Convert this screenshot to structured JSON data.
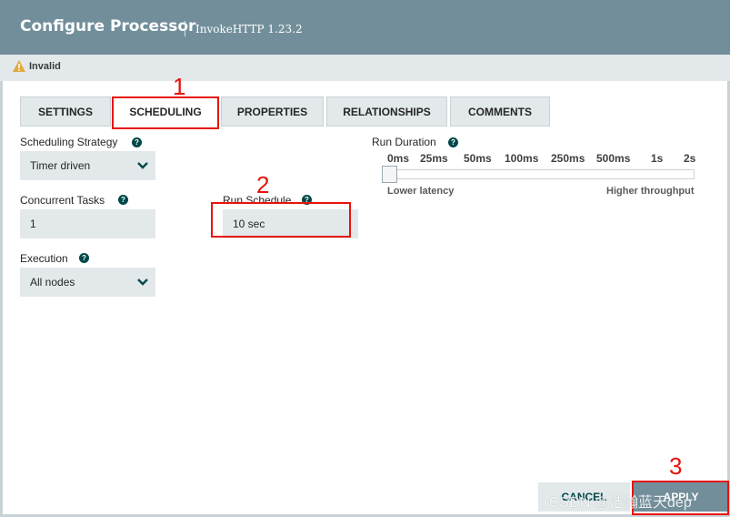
{
  "header": {
    "title": "Configure Processor",
    "subtitle": "InvokeHTTP 1.23.2"
  },
  "status": {
    "icon": "warning-icon",
    "text": "Invalid"
  },
  "tabs": [
    {
      "label": "SETTINGS",
      "active": false
    },
    {
      "label": "SCHEDULING",
      "active": true
    },
    {
      "label": "PROPERTIES",
      "active": false
    },
    {
      "label": "RELATIONSHIPS",
      "active": false
    },
    {
      "label": "COMMENTS",
      "active": false
    }
  ],
  "form": {
    "scheduling_strategy": {
      "label": "Scheduling Strategy",
      "value": "Timer driven"
    },
    "concurrent_tasks": {
      "label": "Concurrent Tasks",
      "value": "1"
    },
    "run_schedule": {
      "label": "Run Schedule",
      "value": "10 sec"
    },
    "execution": {
      "label": "Execution",
      "value": "All nodes"
    },
    "run_duration": {
      "label": "Run Duration",
      "ticks": [
        "0ms",
        "25ms",
        "50ms",
        "100ms",
        "250ms",
        "500ms",
        "1s",
        "2s"
      ],
      "selected": "0ms",
      "low_label": "Lower latency",
      "high_label": "Higher throughput"
    }
  },
  "help_glyph": "?",
  "annotations": [
    "1",
    "2",
    "3"
  ],
  "buttons": {
    "cancel": "CANCEL",
    "apply": "APPLY"
  },
  "watermark": "CSDN @浩瀚蓝天dep",
  "colors": {
    "header": "#728e9b",
    "accent": "#004849",
    "field": "#e3e8eb",
    "annotation": "#e8130c"
  }
}
